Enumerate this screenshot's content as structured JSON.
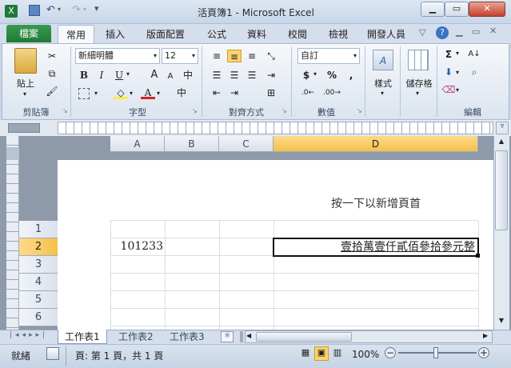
{
  "window": {
    "title": "活頁簿1 - Microsoft Excel",
    "min": "▁",
    "max": "▭",
    "close": "✕"
  },
  "tabs": [
    "檔案",
    "常用",
    "插入",
    "版面配置",
    "公式",
    "資料",
    "校閱",
    "檢視",
    "開發人員"
  ],
  "ribbon": {
    "clipboard": {
      "label": "剪貼簿",
      "paste": "貼上"
    },
    "font": {
      "label": "字型",
      "name": "新細明體",
      "size": "12",
      "bold": "B",
      "italic": "I",
      "underline": "U",
      "grow": "A",
      "shrink": "A"
    },
    "alignment": {
      "label": "對齊方式"
    },
    "number": {
      "label": "數值",
      "format": "自訂",
      "currency": "$",
      "percent": "%",
      "comma": ","
    },
    "styles": {
      "label": "樣式"
    },
    "cells": {
      "label": "儲存格"
    },
    "editing": {
      "label": "編輯"
    }
  },
  "columns": [
    "A",
    "B",
    "C",
    "D"
  ],
  "rows": [
    "1",
    "2",
    "3",
    "4",
    "5",
    "6"
  ],
  "header_prompt": "按一下以新增頁首",
  "cells": {
    "A2": "101233",
    "D2": "壹拾萬壹仟貳佰參拾參元整"
  },
  "sheet_tabs": [
    "工作表1",
    "工作表2",
    "工作表3"
  ],
  "status": {
    "ready": "就緒",
    "page_info": "頁: 第 1 頁，共 1 頁",
    "zoom": "100%"
  },
  "colors": {
    "file_tab": "#1d7a34",
    "selection": "#f5c14a",
    "page_bg": "#8e9aaa"
  }
}
